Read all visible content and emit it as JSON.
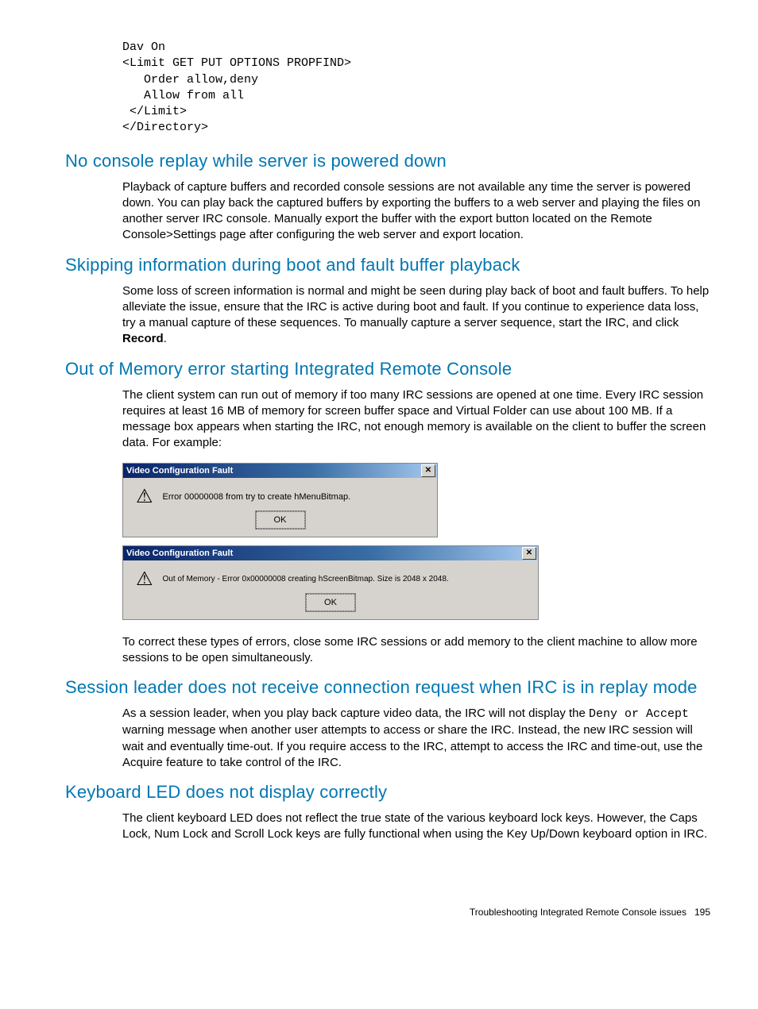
{
  "codeBlock": "Dav On\n<Limit GET PUT OPTIONS PROPFIND>\n   Order allow,deny\n   Allow from all\n </Limit>\n</Directory>",
  "sections": {
    "s1": {
      "heading": "No console replay while server is powered down",
      "para": "Playback of capture buffers and recorded console sessions are not available any time the server is powered down. You can play back the captured buffers by exporting the buffers to a web server and playing the files on another server IRC console. Manually export the buffer with the export button located on the Remote Console>Settings page after configuring the web server and export location."
    },
    "s2": {
      "heading": "Skipping information during boot and fault buffer playback",
      "para_a": "Some loss of screen information is normal and might be seen during play back of boot and fault buffers. To help alleviate the issue, ensure that the IRC is active during boot and fault. If you continue to experience data loss, try a manual capture of these sequences. To manually capture a server sequence, start the IRC, and click ",
      "record": "Record",
      "para_b": "."
    },
    "s3": {
      "heading": "Out of Memory error starting Integrated Remote Console",
      "para1": "The client system can run out of memory if too many IRC sessions are opened at one time. Every IRC session requires at least 16 MB of memory for screen buffer space and Virtual Folder can use about 100 MB. If a message box appears when starting the IRC, not enough memory is available on the client to buffer the screen data. For example:",
      "para2": "To correct these types of errors, close some IRC sessions or add memory to the client machine to allow more sessions to be open simultaneously."
    },
    "s4": {
      "heading": "Session leader does not receive connection request when IRC is in replay mode",
      "para_a": "As a session leader, when you play back capture video data, the IRC will not display the ",
      "mono": "Deny or Accept",
      "para_b": " warning message when another user attempts to access or share the IRC. Instead, the new IRC session will wait and eventually time-out. If you require access to the IRC, attempt to access the IRC and time-out, use the Acquire feature to take control of the IRC."
    },
    "s5": {
      "heading": "Keyboard LED does not display correctly",
      "para": "The client keyboard LED does not reflect the true state of the various keyboard lock keys. However, the Caps Lock, Num Lock and Scroll Lock keys are fully functional when using the Key Up/Down keyboard option in IRC."
    }
  },
  "dialogs": {
    "d1": {
      "title": "Video Configuration Fault",
      "message": "Error 00000008 from try to create hMenuBitmap.",
      "ok": "OK"
    },
    "d2": {
      "title": "Video Configuration Fault",
      "message": "Out of Memory - Error 0x00000008 creating hScreenBitmap. Size is 2048 x 2048.",
      "ok": "OK"
    }
  },
  "footer": {
    "text": "Troubleshooting Integrated Remote Console issues",
    "page": "195"
  },
  "icons": {
    "warning": "⚠",
    "close": "✕"
  }
}
